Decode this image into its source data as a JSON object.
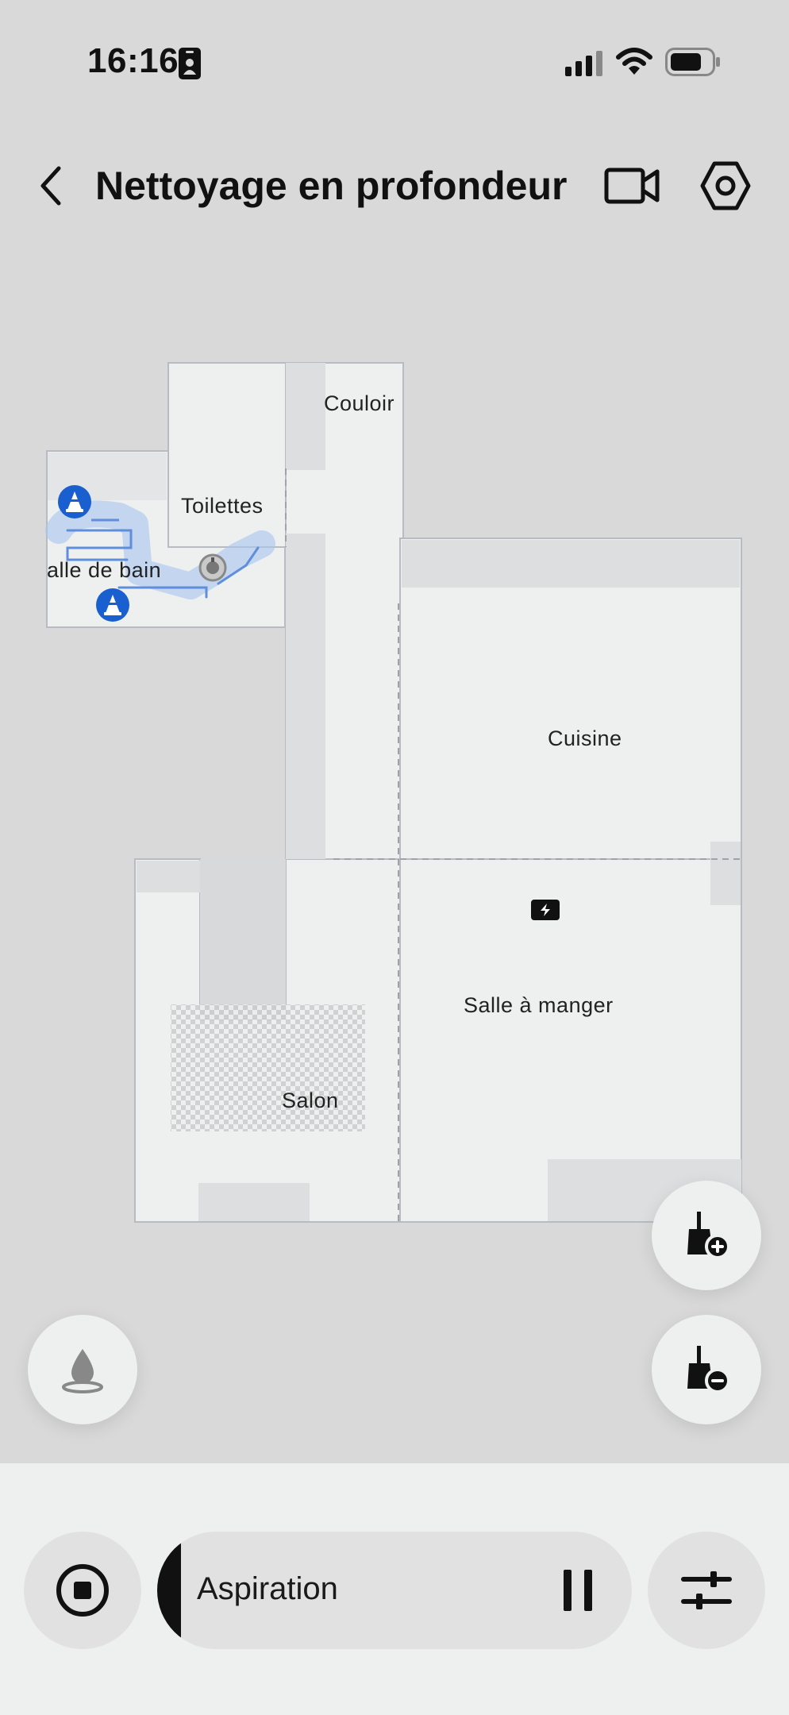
{
  "status_bar": {
    "time": "16:16",
    "icons": [
      "id-card-icon",
      "cellular-signal-icon",
      "wifi-icon",
      "battery-icon"
    ]
  },
  "header": {
    "title": "Nettoyage en profondeur",
    "icons": [
      "back-icon",
      "video-camera-icon",
      "settings-hexagon-icon"
    ]
  },
  "map": {
    "rooms": [
      {
        "id": "couloir",
        "label": "Couloir"
      },
      {
        "id": "toilettes",
        "label": "Toilettes"
      },
      {
        "id": "salle-de-bain",
        "label": "alle de bain"
      },
      {
        "id": "cuisine",
        "label": "Cuisine"
      },
      {
        "id": "salle-a-manger",
        "label": "Salle à manger"
      },
      {
        "id": "salon",
        "label": "Salon"
      }
    ],
    "markers": [
      "no-go-cone-icon",
      "robot-icon",
      "charging-dock-icon"
    ],
    "accent_color": "#1a5fd0"
  },
  "controls": {
    "left_fab": "water-drop-icon",
    "right_fabs": [
      "broom-add-icon",
      "broom-remove-icon"
    ]
  },
  "bottom_bar": {
    "mode_label": "Aspiration",
    "progress_fraction": 0.05,
    "icons": [
      "stop-icon",
      "pause-icon",
      "sliders-icon"
    ]
  }
}
